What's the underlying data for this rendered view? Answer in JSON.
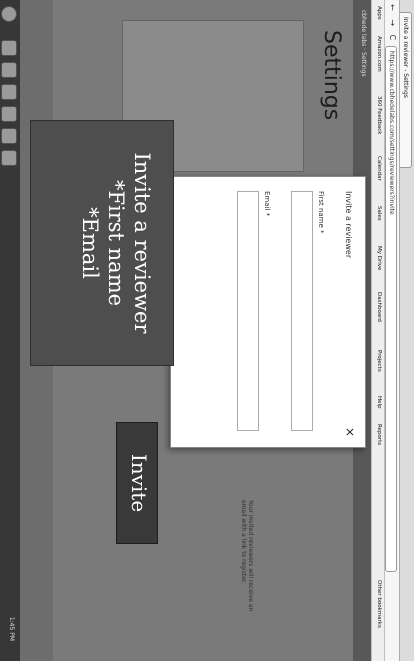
{
  "browser": {
    "tab_title": "Invite a reviewer - Settings",
    "url": "https://www.cbhedelabs.com/settings/reviewers?invite",
    "nav_glyphs": "← → C",
    "bookmarks": [
      "Apps",
      "Amazon.com",
      "360 Feedback",
      "Calendar",
      "Sales",
      "My Drive",
      "Dashboard",
      "Projects",
      "Help",
      "Reports",
      "Other bookmarks"
    ]
  },
  "app": {
    "header_text": "cbhede labs · Settings",
    "page_title": "Settings",
    "side_text": "Your invited reviewers will receive an email with a link to register."
  },
  "dialog": {
    "title": "Invite a reviewer",
    "first_name_label": "First name *",
    "email_label": "Email *",
    "close_glyph": "×"
  },
  "annotation": {
    "line1": "Invite a reviewer",
    "line2": "*First name",
    "line3": "*Email",
    "invite_label": "Invite"
  },
  "taskbar": {
    "clock": "1:45 PM"
  },
  "colors": {
    "scan_bg": "#6e6e6e",
    "dialog_bg": "#ffffff",
    "note_bg": "#505050",
    "invite_bg": "#3c3c3c"
  }
}
